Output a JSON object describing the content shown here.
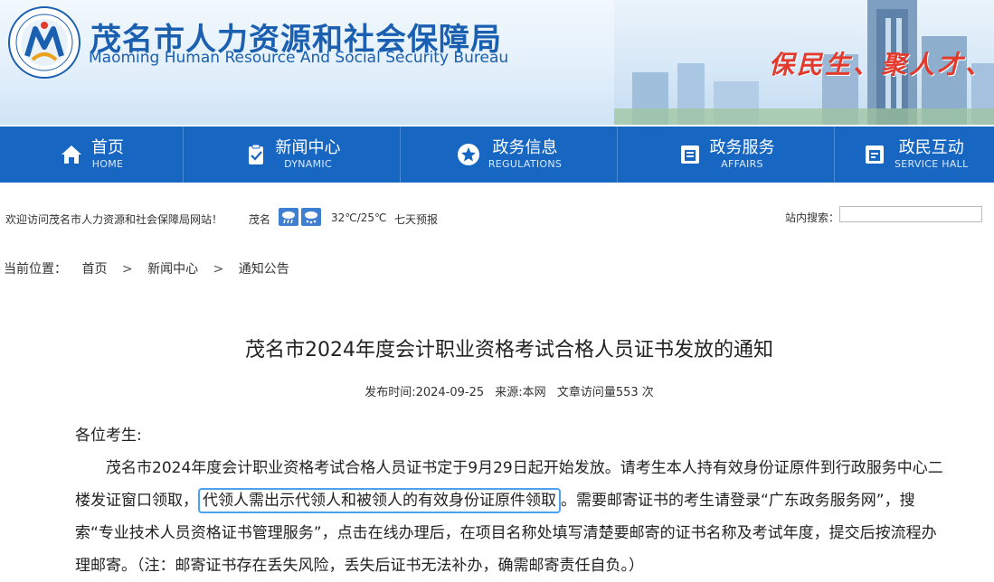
{
  "header": {
    "title_cn": "茂名市人力资源和社会保障局",
    "title_en": "Maoming Human Resource And Social Security Bureau",
    "slogan": "保民生、聚人才、促发"
  },
  "nav": [
    {
      "cn": "首页",
      "en": "HOME",
      "icon": "home-icon"
    },
    {
      "cn": "新闻中心",
      "en": "DYNAMIC",
      "icon": "clipboard-check-icon"
    },
    {
      "cn": "政务信息",
      "en": "REGULATIONS",
      "icon": "star-circle-icon"
    },
    {
      "cn": "政务服务",
      "en": "AFFAIRS",
      "icon": "document-icon"
    },
    {
      "cn": "政民互动",
      "en": "SERVICE HALL",
      "icon": "chat-document-icon"
    }
  ],
  "infobar": {
    "welcome": "欢迎访问茂名市人力资源和社会保障局网站！",
    "city": "茂名",
    "weather_icons": [
      "rain-icon",
      "snow-rain-icon"
    ],
    "temp": "32℃/25℃",
    "forecast": "七天预报",
    "search_label": "站内搜索：",
    "search_value": ""
  },
  "breadcrumb": {
    "label": "当前位置：",
    "items": [
      "首页",
      "新闻中心",
      "通知公告"
    ],
    "sep": ">"
  },
  "article": {
    "title": "茂名市2024年度会计职业资格考试合格人员证书发放的通知",
    "publish": "发布时间:2024-09-25",
    "source": "来源:本网",
    "views": "文章访问量553 次",
    "greeting": "各位考生:",
    "para_before": "茂名市2024年度会计职业资格考试合格人员证书定于9月29日起开始发放。请考生本人持有效身份证原件到行政服务中心二楼发证窗口领取，",
    "para_highlight": "代领人需出示代领人和被领人的有效身份证原件领取",
    "para_after": "。需要邮寄证书的考生请登录“广东政务服务网”，搜索“专业技术人员资格证书管理服务”，点击在线办理后，在项目名称处填写清楚要邮寄的证书名称及考试年度，提交后按流程办理邮寄。（注：邮寄证书存在丢失风险，丢失后证书无法补办，确需邮寄责任自负。）"
  },
  "colors": {
    "nav_bg": "#1766c1",
    "brand_blue": "#1a5fb0",
    "slogan_red": "#e23a2c",
    "highlight_border": "#4aa3f0"
  }
}
